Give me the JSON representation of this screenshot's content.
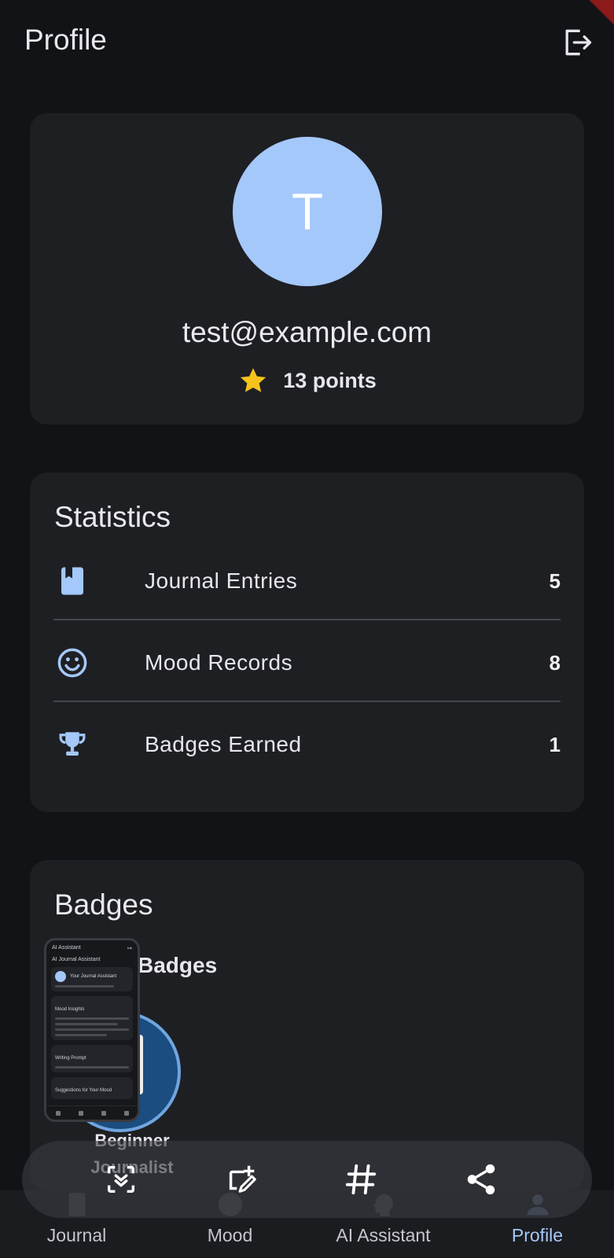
{
  "app": {
    "title": "Profile"
  },
  "profile": {
    "avatar_initial": "T",
    "email": "test@example.com",
    "points_text": "13 points"
  },
  "statistics": {
    "heading": "Statistics",
    "rows": [
      {
        "label": "Journal Entries",
        "value": "5",
        "icon": "bookmark-book-icon"
      },
      {
        "label": "Mood Records",
        "value": "8",
        "icon": "smiley-face-icon"
      },
      {
        "label": "Badges Earned",
        "value": "1",
        "icon": "trophy-icon"
      }
    ]
  },
  "badges": {
    "heading": "Badges",
    "earned_heading": "Badges",
    "items": [
      {
        "name": "Beginner Journalist",
        "icon": "document-badge-icon"
      }
    ]
  },
  "screenshot_thumbnail": {
    "app_title": "AI Assistant",
    "heading": "AI Journal Assistant",
    "assistant_title": "Your Journal Assistant",
    "sections": [
      "Mood Insights",
      "Writing Prompt",
      "Suggestions for Your Mood"
    ]
  },
  "bottom_nav": {
    "items": [
      {
        "label": "Journal",
        "icon": "book-icon"
      },
      {
        "label": "Mood",
        "icon": "mood-face-icon"
      },
      {
        "label": "AI Assistant",
        "icon": "psychology-icon"
      },
      {
        "label": "Profile",
        "icon": "person-icon",
        "active": true
      }
    ]
  },
  "overlay_actions": [
    "scan-icon",
    "edit-crop-icon",
    "hashtag-icon",
    "share-icon"
  ],
  "colors": {
    "accent": "#a4c8fa",
    "star": "#f6c21c",
    "background": "#121316",
    "card": "#1e1f23"
  }
}
